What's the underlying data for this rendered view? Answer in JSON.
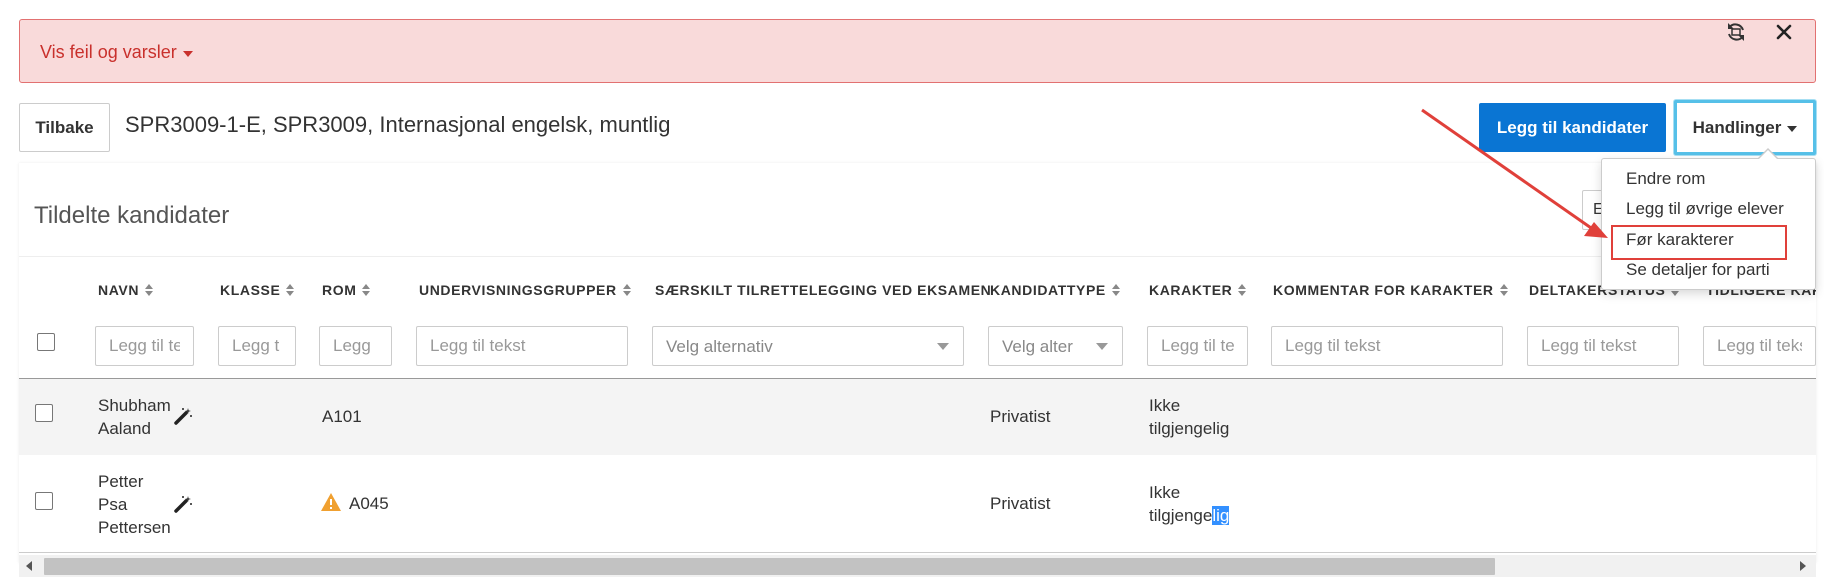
{
  "alert": {
    "toggle_label": "Vis feil og varsler",
    "refresh_icon": "refresh-icon",
    "close_icon": "close-icon"
  },
  "header": {
    "back_label": "Tilbake",
    "title": "SPR3009-1-E, SPR3009, Internasjonal engelsk, muntlig",
    "add_label": "Legg til kandidater",
    "actions_label": "Handlinger"
  },
  "panel": {
    "title": "Tildelte kandidater",
    "partial_button": "E"
  },
  "menu": {
    "items": [
      "Endre rom",
      "Legg til øvrige elever",
      "Før karakterer",
      "Se detaljer for parti"
    ]
  },
  "table": {
    "columns": [
      "NAVN",
      "KLASSE",
      "ROM",
      "UNDERVISNINGSGRUPPER",
      "SÆRSKILT TILRETTELEGGING VED EKSAMEN",
      "KANDIDATTYPE",
      "KARAKTER",
      "KOMMENTAR FOR KARAKTER",
      "DELTAKERSTATUS",
      "TIDLIGERE KARA"
    ],
    "filters": [
      "Legg til te",
      "Legg t",
      "Legg",
      "Legg til tekst",
      "Velg alternativ",
      "Velg alter",
      "Legg til te",
      "Legg til tekst",
      "Legg til tekst",
      "Legg til tekst"
    ],
    "rows": [
      {
        "name_line1": "Shubham",
        "name_line2": "Aaland",
        "rom": "A101",
        "kandidattype": "Privatist",
        "karakter_line1": "Ikke",
        "karakter_line2": "tilgjengelig"
      },
      {
        "name_line1": "Petter",
        "name_line2": "Psa",
        "name_line3": "Pettersen",
        "rom": "A045",
        "kandidattype": "Privatist",
        "karakter_line1": "Ikke",
        "karakter_line2a": "tilgjenge",
        "karakter_line2b": "lig"
      }
    ]
  },
  "colors": {
    "alert_bg": "#f9dada",
    "alert_text": "#c9302c",
    "primary": "#0a75d3",
    "annotation": "#e0403a",
    "warning": "#f0a030"
  }
}
